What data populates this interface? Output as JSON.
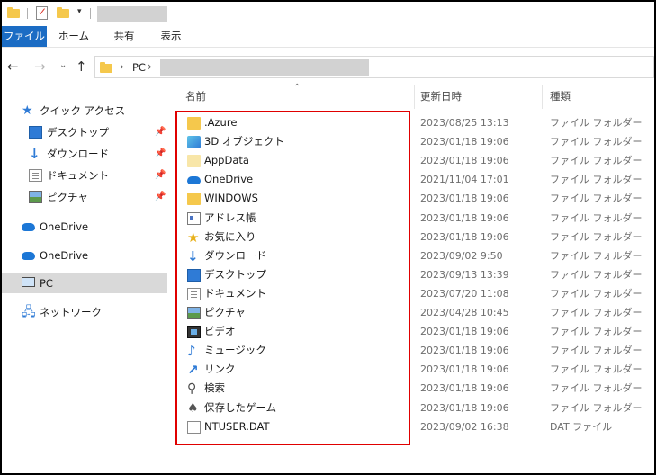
{
  "ribbon": {
    "tabs": [
      "ファイル",
      "ホーム",
      "共有",
      "表示"
    ]
  },
  "address": {
    "pc_label": "PC"
  },
  "columns": {
    "name": "名前",
    "modified": "更新日時",
    "type": "種類"
  },
  "navpane": {
    "quick_access": "クイック アクセス",
    "quick_items": [
      {
        "label": "デスクトップ",
        "icon": "desktop-icon"
      },
      {
        "label": "ダウンロード",
        "icon": "download-icon"
      },
      {
        "label": "ドキュメント",
        "icon": "documents-icon"
      },
      {
        "label": "ピクチャ",
        "icon": "pictures-icon"
      }
    ],
    "onedrive_1": "OneDrive",
    "onedrive_2": "OneDrive",
    "pc": "PC",
    "network": "ネットワーク"
  },
  "files": [
    {
      "name": ".Azure",
      "date": "2023/08/25 13:13",
      "type": "ファイル フォルダー",
      "icon": "folder-icon"
    },
    {
      "name": "3D オブジェクト",
      "date": "2023/01/18 19:06",
      "type": "ファイル フォルダー",
      "icon": "3d-objects-icon"
    },
    {
      "name": "AppData",
      "date": "2023/01/18 19:06",
      "type": "ファイル フォルダー",
      "icon": "folder-icon"
    },
    {
      "name": "OneDrive",
      "date": "2021/11/04 17:01",
      "type": "ファイル フォルダー",
      "icon": "onedrive-icon"
    },
    {
      "name": "WINDOWS",
      "date": "2023/01/18 19:06",
      "type": "ファイル フォルダー",
      "icon": "folder-icon"
    },
    {
      "name": "アドレス帳",
      "date": "2023/01/18 19:06",
      "type": "ファイル フォルダー",
      "icon": "contacts-icon"
    },
    {
      "name": "お気に入り",
      "date": "2023/01/18 19:06",
      "type": "ファイル フォルダー",
      "icon": "favorites-icon"
    },
    {
      "name": "ダウンロード",
      "date": "2023/09/02 9:50",
      "type": "ファイル フォルダー",
      "icon": "download-icon"
    },
    {
      "name": "デスクトップ",
      "date": "2023/09/13 13:39",
      "type": "ファイル フォルダー",
      "icon": "desktop-icon"
    },
    {
      "name": "ドキュメント",
      "date": "2023/07/20 11:08",
      "type": "ファイル フォルダー",
      "icon": "documents-icon"
    },
    {
      "name": "ピクチャ",
      "date": "2023/04/28 10:45",
      "type": "ファイル フォルダー",
      "icon": "pictures-icon"
    },
    {
      "name": "ビデオ",
      "date": "2023/01/18 19:06",
      "type": "ファイル フォルダー",
      "icon": "videos-icon"
    },
    {
      "name": "ミュージック",
      "date": "2023/01/18 19:06",
      "type": "ファイル フォルダー",
      "icon": "music-icon"
    },
    {
      "name": "リンク",
      "date": "2023/01/18 19:06",
      "type": "ファイル フォルダー",
      "icon": "links-icon"
    },
    {
      "name": "検索",
      "date": "2023/01/18 19:06",
      "type": "ファイル フォルダー",
      "icon": "searches-icon"
    },
    {
      "name": "保存したゲーム",
      "date": "2023/01/18 19:06",
      "type": "ファイル フォルダー",
      "icon": "saved-games-icon"
    },
    {
      "name": "NTUSER.DAT",
      "date": "2023/09/02 16:38",
      "type": "DAT ファイル",
      "icon": "file-icon"
    }
  ],
  "colors": {
    "accent": "#1b6cc4",
    "highlight": "#e00000",
    "selected_bg": "#d9d9d9"
  }
}
